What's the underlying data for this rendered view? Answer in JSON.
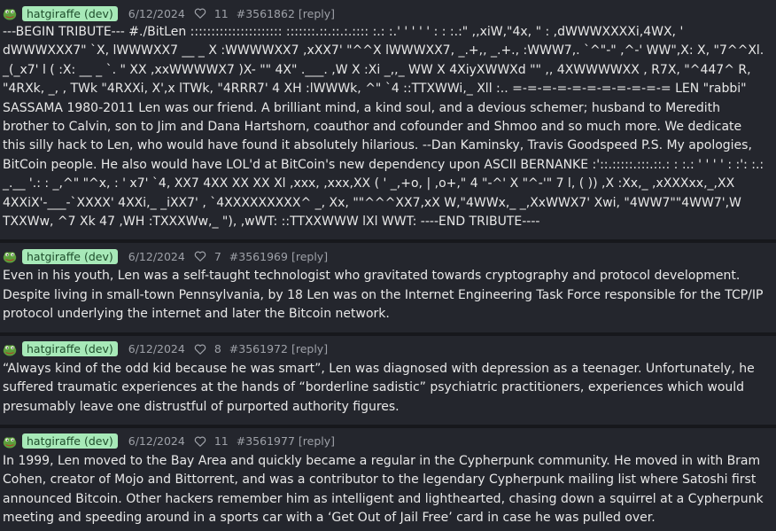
{
  "posts": [
    {
      "username": "hatgiraffe (dev)",
      "date": "6/12/2024",
      "likes": "11",
      "post_id": "#3561862",
      "reply_label": "[reply]",
      "body": "---BEGIN TRIBUTE--- #./BitLen :::::::::::::::::::::: :::::::.::.::.:.:::: :.: :.' ' ' ' ' : : :.:\" ,,xiW,\"4x, \" : ,dWWWXXXXi,4WX, ' dWWWXXX7\" `X, lWWWXX7 __ _ X :WWWWXX7 ,xXX7' \"^^X lWWWXX7, _.+,, _.+., :WWW7,. `^\"-\" ,^-' WW\",X: X, \"7^^Xl. _(_x7' l ( :X: __ _ `. \" XX ,xxWWWWX7 )X- \"\" 4X\" .___. ,W X :Xi _,,_ WW X 4XiyXWWXd \"\" ,, 4XWWWWXX , R7X, \"^447^ R, \"4RXk, _, , TWk \"4RXXi, X',x lTWk, \"4RRR7' 4 XH :lWWWk, ^\" `4 ::TTXWWi,_ Xll :.. =-=-=-=-=-=-=-=-=-=-= LEN \"rabbi\" SASSAMA 1980-2011 Len was our friend. A brilliant mind, a kind soul, and a devious schemer; husband to Meredith brother to Calvin, son to Jim and Dana Hartshorn, coauthor and cofounder and Shmoo and so much more. We dedicate this silly hack to Len, who would have found it absolutely hilarious. --Dan Kaminsky, Travis Goodspeed P.S. My apologies, BitCoin people. He also would have LOL'd at BitCoin's new dependency upon ASCII BERNANKE :'::.:::::.:::.::.: : :.: ' ' ' ' : :': :.: _.__ '.: : _,^\" \"^x, : ' x7' `4, XX7 4XX XX XX Xl ,xxx, ,xxx,XX ( ' _,+o, | ,o+,\" 4 \"-^' X \"^-'\" 7 l, ( )) ,X :Xx,_ ,xXXXxx,_,XX 4XXiX'-___-`XXXX' 4XXi,_ _iXX7' , `4XXXXXXXXX^ _, Xx, \"\"^^^XX7,xX W,\"4WWx,_ _,XxWWX7' Xwi, \"4WW7\"\"4WW7',W TXXWw, ^7 Xk 47 ,WH :TXXXWw,_ \"), ,wWT: ::TTXXWWW lXl WWT: ----END TRIBUTE----"
    },
    {
      "username": "hatgiraffe (dev)",
      "date": "6/12/2024",
      "likes": "7",
      "post_id": "#3561969",
      "reply_label": "[reply]",
      "body": "Even in his youth, Len was a self-taught technologist who gravitated towards cryptography and protocol development. Despite living in small-town Pennsylvania, by 18 Len was on the Internet Engineering Task Force responsible for the TCP/IP protocol underlying the internet and later the Bitcoin network."
    },
    {
      "username": "hatgiraffe (dev)",
      "date": "6/12/2024",
      "likes": "8",
      "post_id": "#3561972",
      "reply_label": "[reply]",
      "body": "“Always kind of the odd kid because he was smart”, Len was diagnosed with depression as a teenager. Unfortunately, he suffered traumatic experiences at the hands of “borderline sadistic” psychiatric practitioners, experiences which would presumably leave one distrustful of purported authority figures."
    },
    {
      "username": "hatgiraffe (dev)",
      "date": "6/12/2024",
      "likes": "11",
      "post_id": "#3561977",
      "reply_label": "[reply]",
      "body": "In 1999, Len moved to the Bay Area and quickly became a regular in the Cypherpunk community. He moved in with Bram Cohen, creator of Mojo and Bittorrent, and was a contributor to the legendary Cypherpunk mailing list where Satoshi first announced Bitcoin. Other hackers remember him as intelligent and lighthearted, chasing down a squirrel at a Cypherpunk meeting and speeding around in a sports car with a ‘Get Out of Jail Free’ card in case he was pulled over."
    }
  ],
  "colors": {
    "background": "#1d1f25",
    "post_background": "#24262d",
    "badge_background": "#a7e9b8",
    "badge_text": "#1e4d2b",
    "meta_text": "#9ea1a8",
    "body_text": "#e8e8e8"
  },
  "icons": {
    "avatar": "pepe-frog-avatar-icon",
    "like": "heart-outline-icon"
  }
}
